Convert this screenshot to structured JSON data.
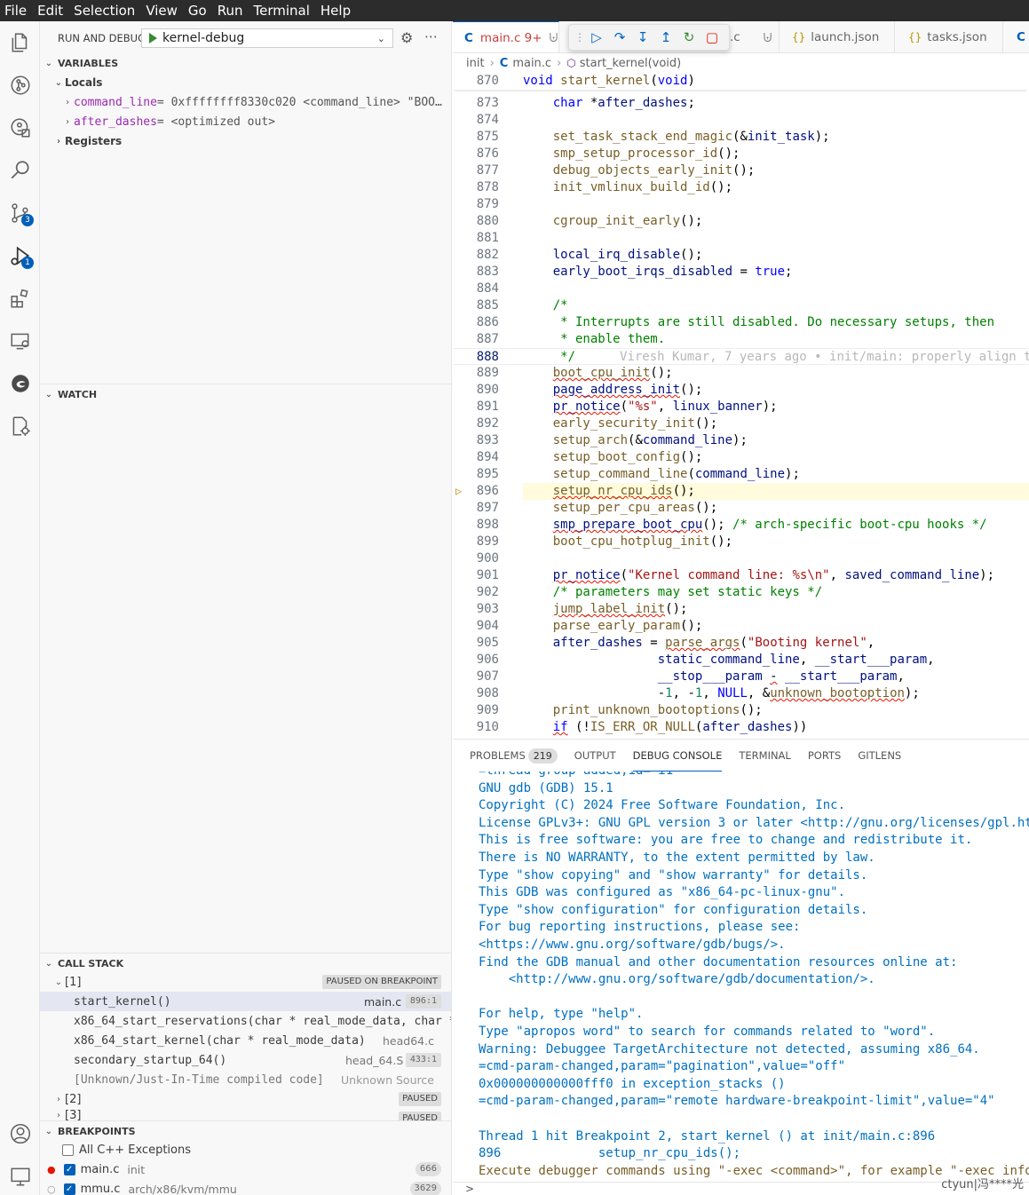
{
  "menu": [
    "File",
    "Edit",
    "Selection",
    "View",
    "Go",
    "Run",
    "Terminal",
    "Help"
  ],
  "activity": {
    "scm_badge": "3",
    "debug_badge": "1"
  },
  "sidebar": {
    "title": "RUN AND DEBUG",
    "config": "kernel-debug",
    "variables": {
      "title": "VARIABLES",
      "locals": "Locals",
      "items": [
        {
          "name": "command_line",
          "value": " = 0xffffffff8330c020 <command_line> \"BOO…"
        },
        {
          "name": "after_dashes",
          "value": " = <optimized out>"
        }
      ],
      "registers": "Registers"
    },
    "watch": {
      "title": "WATCH"
    },
    "callstack": {
      "title": "CALL STACK",
      "thread1": "[1]",
      "thread1_status": "PAUSED ON BREAKPOINT",
      "frames": [
        {
          "fn": "start_kernel()",
          "file": "main.c",
          "loc": "896:1"
        },
        {
          "fn": "x86_64_start_reservations(char * real_mode_data, char *",
          "file": "",
          "loc": ""
        },
        {
          "fn": "x86_64_start_kernel(char * real_mode_data)",
          "file": "head64.c",
          "loc": ""
        },
        {
          "fn": "secondary_startup_64()",
          "file": "head_64.S",
          "loc": "433:1"
        },
        {
          "fn": "[Unknown/Just-In-Time compiled code]",
          "file": "Unknown Source",
          "loc": ""
        }
      ],
      "thread2": "[2]",
      "thread2_status": "PAUSED",
      "thread3": "[3]",
      "thread3_status": "PAUSED"
    },
    "breakpoints": {
      "title": "BREAKPOINTS",
      "all_cpp": "All C++ Exceptions",
      "items": [
        {
          "file": "main.c",
          "dir": "init",
          "line": "666"
        },
        {
          "file": "mmu.c",
          "dir": "arch/x86/kvm/mmu",
          "line": "3629"
        }
      ]
    }
  },
  "editor": {
    "tabs": [
      {
        "label": "main.c 9+",
        "icon": "C"
      },
      {
        "label": ".c",
        "icon": ""
      },
      {
        "label": "launch.json",
        "icon": "{}"
      },
      {
        "label": "tasks.json",
        "icon": "{}"
      },
      {
        "label": "C",
        "icon": ""
      }
    ],
    "breadcrumb": {
      "folder": "init",
      "file": "main.c",
      "symbol": "start_kernel(void)",
      "file_icon": "C"
    },
    "current_line": "896",
    "blame": "Viresh Kumar, 7 years ago • init/main: properly align t"
  },
  "panel": {
    "tabs": [
      {
        "label": "PROBLEMS",
        "count": "219"
      },
      {
        "label": "OUTPUT"
      },
      {
        "label": "DEBUG CONSOLE"
      },
      {
        "label": "TERMINAL"
      },
      {
        "label": "PORTS"
      },
      {
        "label": "GITLENS"
      }
    ],
    "lines": [
      {
        "t": "=thread-group-added,id=\"i1\"",
        "c": "i"
      },
      {
        "t": "GNU gdb (GDB) 15.1",
        "c": "i"
      },
      {
        "t": "Copyright (C) 2024 Free Software Foundation, Inc.",
        "c": "i"
      },
      {
        "t": "License GPLv3+: GNU GPL version 3 or later <http://gnu.org/licenses/gpl.ht",
        "c": "i"
      },
      {
        "t": "This is free software: you are free to change and redistribute it.",
        "c": "i"
      },
      {
        "t": "There is NO WARRANTY, to the extent permitted by law.",
        "c": "i"
      },
      {
        "t": "Type \"show copying\" and \"show warranty\" for details.",
        "c": "i"
      },
      {
        "t": "This GDB was configured as \"x86_64-pc-linux-gnu\".",
        "c": "i"
      },
      {
        "t": "Type \"show configuration\" for configuration details.",
        "c": "i"
      },
      {
        "t": "For bug reporting instructions, please see:",
        "c": "i"
      },
      {
        "t": "<https://www.gnu.org/software/gdb/bugs/>.",
        "c": "i"
      },
      {
        "t": "Find the GDB manual and other documentation resources online at:",
        "c": "i"
      },
      {
        "t": "    <http://www.gnu.org/software/gdb/documentation/>.",
        "c": "i"
      },
      {
        "t": "",
        "c": "i"
      },
      {
        "t": "For help, type \"help\".",
        "c": "i"
      },
      {
        "t": "Type \"apropos word\" to search for commands related to \"word\".",
        "c": "i"
      },
      {
        "t": "Warning: Debuggee TargetArchitecture not detected, assuming x86_64.",
        "c": "i"
      },
      {
        "t": "=cmd-param-changed,param=\"pagination\",value=\"off\"",
        "c": "i"
      },
      {
        "t": "0x000000000000fff0 in exception_stacks ()",
        "c": "i"
      },
      {
        "t": "=cmd-param-changed,param=\"remote hardware-breakpoint-limit\",value=\"4\"",
        "c": "i"
      },
      {
        "t": "",
        "c": "i"
      },
      {
        "t": "Thread 1 hit Breakpoint 2, start_kernel () at init/main.c:896",
        "c": "i"
      },
      {
        "t": "896             setup_nr_cpu_ids();",
        "c": "i"
      },
      {
        "t": "Execute debugger commands using \"-exec <command>\", for example \"-exec info",
        "c": "w"
      }
    ],
    "prompt": ">"
  },
  "watermark": "ctyun|冯****光"
}
